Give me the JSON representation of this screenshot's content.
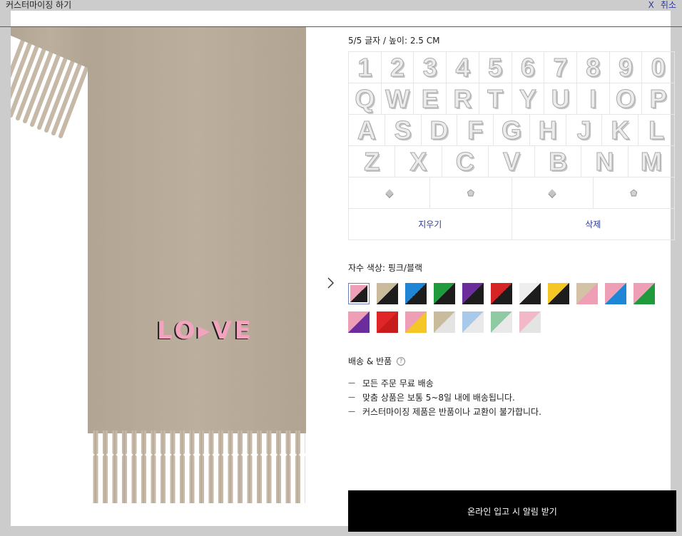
{
  "header": {
    "title": "커스터마이징 하기",
    "close_x": "X",
    "close_label": "취소"
  },
  "preview": {
    "text": "LO▸VE"
  },
  "icons": {
    "next": "chevron-right-icon",
    "help": "question-circle-icon"
  },
  "engraving": {
    "info": "5/5 글자 / 높이: 2.5 CM",
    "keyboard": {
      "rows": [
        [
          "1",
          "2",
          "3",
          "4",
          "5",
          "6",
          "7",
          "8",
          "9",
          "0"
        ],
        [
          "Q",
          "W",
          "E",
          "R",
          "T",
          "Y",
          "U",
          "I",
          "O",
          "P"
        ],
        [
          "A",
          "S",
          "D",
          "F",
          "G",
          "H",
          "J",
          "K",
          "L"
        ],
        [
          "Z",
          "X",
          "C",
          "V",
          "B",
          "N",
          "M"
        ]
      ],
      "symbols": [
        "diamond-icon",
        "pentagon-icon",
        "diamond-icon",
        "pentagon-icon"
      ],
      "erase_label": "지우기",
      "delete_label": "삭제"
    }
  },
  "thread_color": {
    "label": "자수 색상: 핑크/블랙",
    "selected_index": 0,
    "swatches": [
      [
        "#ee9fb6",
        "#1d1d1d"
      ],
      [
        "#cbbb9d",
        "#1d1d1d"
      ],
      [
        "#1f86d6",
        "#1d1d1d"
      ],
      [
        "#1f9a3c",
        "#1d1d1d"
      ],
      [
        "#6b2d9c",
        "#1d1d1d"
      ],
      [
        "#d62424",
        "#1d1d1d"
      ],
      [
        "#eeeeee",
        "#1d1d1d"
      ],
      [
        "#f4c726",
        "#1d1d1d"
      ],
      [
        "#d4c2a6",
        "#ee9fb6"
      ],
      [
        "#ee9fb6",
        "#1f86d6"
      ],
      [
        "#ee9fb6",
        "#1f9a3c"
      ],
      [
        "#ee9fb6",
        "#6b2d9c"
      ],
      [
        "#e02626",
        "#c81c1c"
      ],
      [
        "#ee9fb6",
        "#f4c726"
      ],
      [
        "#cbbb9d",
        "#e4e4e4"
      ],
      [
        "#a9c9ea",
        "#e9e9e9"
      ],
      [
        "#8fcaa2",
        "#e9e9e9"
      ],
      [
        "#f2b8c8",
        "#e4e4e4"
      ]
    ]
  },
  "shipping": {
    "title": "배송 & 반품",
    "help_glyph": "?",
    "bullet": "—",
    "items": [
      "모든 주문 무료 배송",
      "맞춤 상품은 보통 5~8일 내에 배송됩니다.",
      "커스터마이징 제품은 반품이나 교환이 불가합니다."
    ]
  },
  "cta": {
    "label": "온라인 입고 시 알림 받기"
  },
  "theme": {
    "accent": "#2d3a9a",
    "overlay": "#cccccc",
    "cta_bg": "#000000",
    "cta_text": "#ffffff"
  }
}
